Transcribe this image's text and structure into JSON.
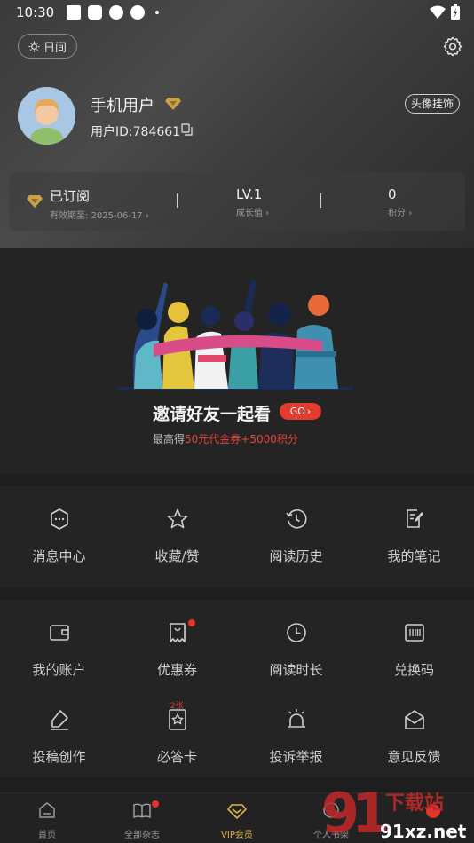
{
  "status_bar": {
    "time": "10:30"
  },
  "header": {
    "day_toggle": "日间",
    "username": "手机用户",
    "user_id": "用户ID:784661",
    "avatar_decoration": "头像挂饰"
  },
  "stats": {
    "subscription": {
      "main": "已订阅",
      "sub": "有效期至: 2025-06-17"
    },
    "level": {
      "main": "LV.1",
      "sub": "成长值"
    },
    "points": {
      "main": "0",
      "sub": "积分"
    }
  },
  "invite": {
    "title": "邀请好友一起看",
    "go_label": "GO",
    "subtitle_prefix": "最高得",
    "subtitle_highlight": "50元代金券+5000积分"
  },
  "quick_menu": [
    {
      "label": "消息中心",
      "icon": "message-icon"
    },
    {
      "label": "收藏/赞",
      "icon": "star-icon"
    },
    {
      "label": "阅读历史",
      "icon": "history-icon"
    },
    {
      "label": "我的笔记",
      "icon": "note-icon"
    }
  ],
  "service_menu": [
    {
      "label": "我的账户",
      "icon": "wallet-icon"
    },
    {
      "label": "优惠券",
      "icon": "coupon-icon",
      "count": "2张"
    },
    {
      "label": "阅读时长",
      "icon": "clock-icon"
    },
    {
      "label": "兑换码",
      "icon": "barcode-icon"
    },
    {
      "label": "投稿创作",
      "icon": "pen-icon"
    },
    {
      "label": "必答卡",
      "icon": "card-icon"
    },
    {
      "label": "投诉举报",
      "icon": "alarm-icon"
    },
    {
      "label": "意见反馈",
      "icon": "feedback-icon"
    }
  ],
  "tabbar": [
    {
      "label": "首页",
      "icon": "home-icon"
    },
    {
      "label": "全部杂志",
      "icon": "magazine-icon"
    },
    {
      "label": "VIP会员",
      "icon": "vip-icon",
      "active": true
    },
    {
      "label": "个人书架",
      "icon": "shelf-icon"
    }
  ],
  "watermark": {
    "brand": "下载站",
    "domain": "91xz.net"
  },
  "colors": {
    "accent_red": "#e33b2e",
    "gold": "#c9a24a",
    "vip_active": "#e0b14a"
  }
}
